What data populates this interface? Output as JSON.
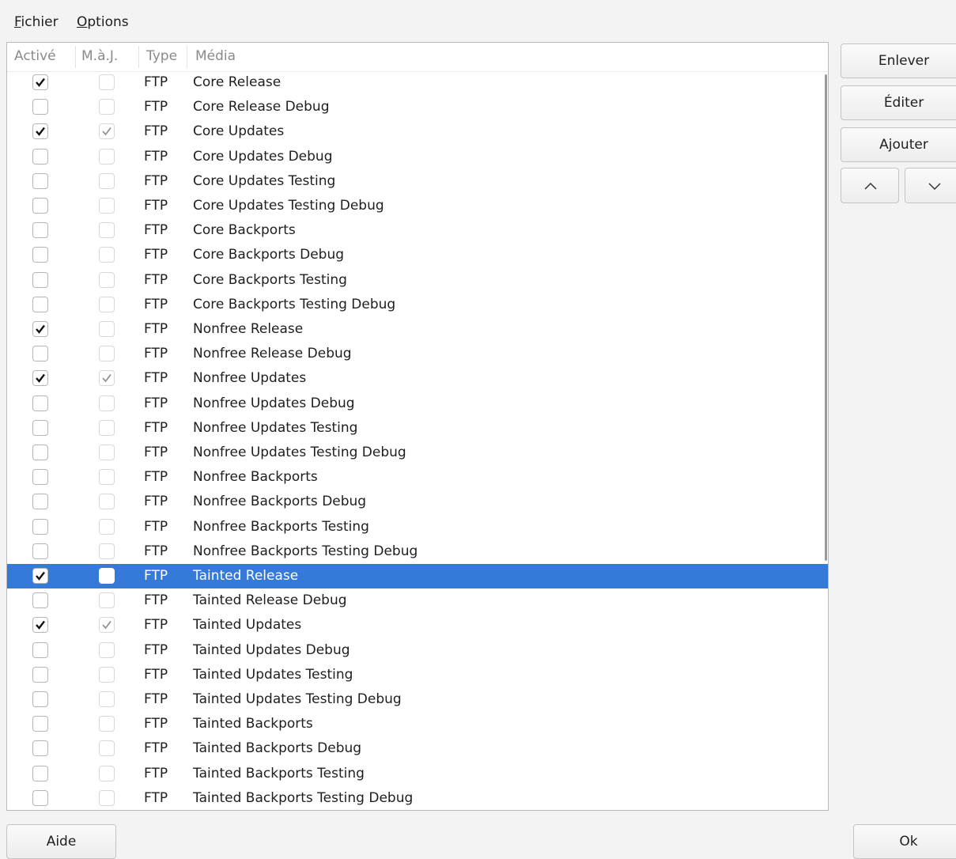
{
  "menu": {
    "fichier": {
      "mnemonic": "F",
      "rest": "ichier"
    },
    "options": {
      "mnemonic": "O",
      "rest": "ptions"
    }
  },
  "table": {
    "headers": {
      "active": "Activé",
      "update": "M.à.J.",
      "type": "Type",
      "media": "Média"
    },
    "rows": [
      {
        "active": true,
        "update": false,
        "type": "FTP",
        "media": "Core Release"
      },
      {
        "active": false,
        "update": false,
        "type": "FTP",
        "media": "Core Release Debug"
      },
      {
        "active": true,
        "update": true,
        "type": "FTP",
        "media": "Core Updates"
      },
      {
        "active": false,
        "update": false,
        "type": "FTP",
        "media": "Core Updates Debug"
      },
      {
        "active": false,
        "update": false,
        "type": "FTP",
        "media": "Core Updates Testing"
      },
      {
        "active": false,
        "update": false,
        "type": "FTP",
        "media": "Core Updates Testing Debug"
      },
      {
        "active": false,
        "update": false,
        "type": "FTP",
        "media": "Core Backports"
      },
      {
        "active": false,
        "update": false,
        "type": "FTP",
        "media": "Core Backports Debug"
      },
      {
        "active": false,
        "update": false,
        "type": "FTP",
        "media": "Core Backports Testing"
      },
      {
        "active": false,
        "update": false,
        "type": "FTP",
        "media": "Core Backports Testing Debug"
      },
      {
        "active": true,
        "update": false,
        "type": "FTP",
        "media": "Nonfree Release"
      },
      {
        "active": false,
        "update": false,
        "type": "FTP",
        "media": "Nonfree Release Debug"
      },
      {
        "active": true,
        "update": true,
        "type": "FTP",
        "media": "Nonfree Updates"
      },
      {
        "active": false,
        "update": false,
        "type": "FTP",
        "media": "Nonfree Updates Debug"
      },
      {
        "active": false,
        "update": false,
        "type": "FTP",
        "media": "Nonfree Updates Testing"
      },
      {
        "active": false,
        "update": false,
        "type": "FTP",
        "media": "Nonfree Updates Testing Debug"
      },
      {
        "active": false,
        "update": false,
        "type": "FTP",
        "media": "Nonfree Backports"
      },
      {
        "active": false,
        "update": false,
        "type": "FTP",
        "media": "Nonfree Backports Debug"
      },
      {
        "active": false,
        "update": false,
        "type": "FTP",
        "media": "Nonfree Backports Testing"
      },
      {
        "active": false,
        "update": false,
        "type": "FTP",
        "media": "Nonfree Backports Testing Debug"
      },
      {
        "active": true,
        "update": false,
        "type": "FTP",
        "media": "Tainted Release",
        "selected": true
      },
      {
        "active": false,
        "update": false,
        "type": "FTP",
        "media": "Tainted Release Debug"
      },
      {
        "active": true,
        "update": true,
        "type": "FTP",
        "media": "Tainted Updates"
      },
      {
        "active": false,
        "update": false,
        "type": "FTP",
        "media": "Tainted Updates Debug"
      },
      {
        "active": false,
        "update": false,
        "type": "FTP",
        "media": "Tainted Updates Testing"
      },
      {
        "active": false,
        "update": false,
        "type": "FTP",
        "media": "Tainted Updates Testing Debug"
      },
      {
        "active": false,
        "update": false,
        "type": "FTP",
        "media": "Tainted Backports"
      },
      {
        "active": false,
        "update": false,
        "type": "FTP",
        "media": "Tainted Backports Debug"
      },
      {
        "active": false,
        "update": false,
        "type": "FTP",
        "media": "Tainted Backports Testing"
      },
      {
        "active": false,
        "update": false,
        "type": "FTP",
        "media": "Tainted Backports Testing Debug"
      }
    ]
  },
  "buttons": {
    "remove": "Enlever",
    "edit": "Éditer",
    "add": "Ajouter",
    "up_icon": "chevron-up",
    "down_icon": "chevron-down",
    "help": "Aide",
    "ok": "Ok"
  },
  "colors": {
    "selection": "#3579d9",
    "window_bg": "#f3f3f3"
  }
}
